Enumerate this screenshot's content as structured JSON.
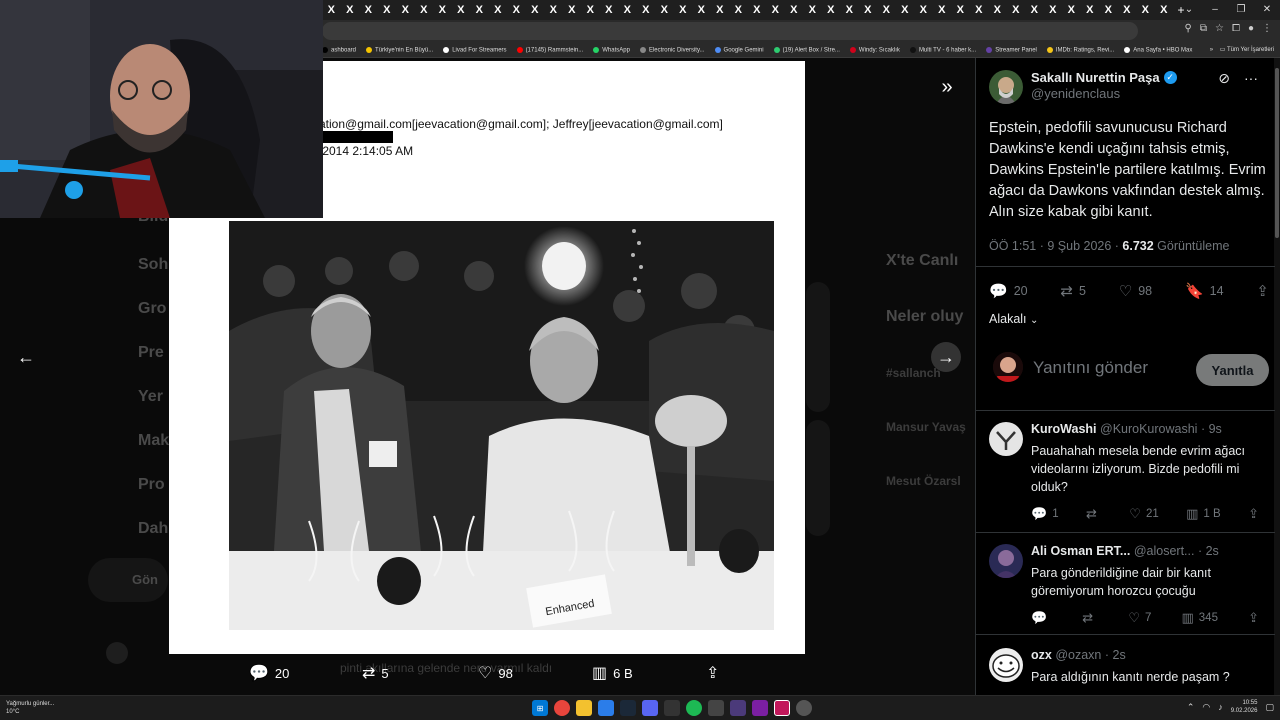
{
  "browser": {
    "tab_glyph": "X",
    "tab_count": 46,
    "new_tab": "+",
    "bookmarks": [
      {
        "label": "ashboard",
        "color": "#000000"
      },
      {
        "label": "Türkiye'nin En Büyü...",
        "color": "#f5c400"
      },
      {
        "label": "Livad For Streamers",
        "color": "#ffffff"
      },
      {
        "label": "(17145) Rammstein...",
        "color": "#ff0000"
      },
      {
        "label": "WhatsApp",
        "color": "#25d366"
      },
      {
        "label": "Electronic Diversity...",
        "color": "#888888"
      },
      {
        "label": "Google Gemini",
        "color": "#4f8df5"
      },
      {
        "label": "(19) Alert Box / Stre...",
        "color": "#2ecc71"
      },
      {
        "label": "Windy: Sıcaklık",
        "color": "#d0021b"
      },
      {
        "label": "Multi TV - 6 haber k...",
        "color": "#111111"
      },
      {
        "label": "Streamer Panel",
        "color": "#6441a5"
      },
      {
        "label": "IMDb: Ratings, Revi...",
        "color": "#f5c518"
      },
      {
        "label": "Ana Sayfa • HBO Max",
        "color": "#ffffff"
      }
    ],
    "bookmarks_more": "»",
    "all_bookmarks": "Tüm Yer İşaretleri"
  },
  "background": {
    "nav_items": [
      "Bildi",
      "Soh",
      "Gro",
      "Pre",
      "Yer",
      "Mak",
      "Pro",
      "Dah"
    ],
    "post_button": "Gön",
    "right_headings": [
      "X'te Canlı",
      "Neler oluy"
    ],
    "ghost_lines": [
      "#sallanch",
      "Mansur Yavaş",
      "Mesut Özarsl"
    ],
    "ghost_tweet": "pinti akıllarına gelende nere varmıl kaldı"
  },
  "document": {
    "to_line": "ation@gmail.com[jeevacation@gmail.com]; Jeffrey[jeevacation@gmail.com]",
    "date_line": "/2014 2:14:05 AM"
  },
  "media_actions": {
    "replies": "20",
    "reposts": "5",
    "likes": "98",
    "views": "6 B"
  },
  "tweet": {
    "author_name": "Sakallı Nurettin Paşa",
    "author_handle": "@yenidenclaus",
    "text": "Epstein, pedofili savunucusu Richard Dawkins'e kendi uçağını tahsis etmiş, Dawkins Epstein'le partilere katılmış. Evrim ağacı da Dawkons vakfından destek almış. Alın size kabak gibi kanıt.",
    "time": "ÖÖ 1:51 · 9 Şub 2026 · ",
    "views_count": "6.732",
    "views_label": " Görüntüleme",
    "replies": "20",
    "reposts": "5",
    "likes": "98",
    "bookmarks": "14",
    "relevant_label": "Alakalı",
    "reply_placeholder": "Yanıtını gönder",
    "reply_button": "Yanıtla"
  },
  "replies": [
    {
      "name": "KuroWashi",
      "handle": "@KuroKurowashi",
      "time": "· 9s",
      "text": "Pauahahah mesela bende evrim ağacı videolarını izliyorum. Bizde pedofili mi olduk?",
      "replies": "1",
      "reposts": "",
      "likes": "21",
      "views": "1 B"
    },
    {
      "name": "Ali Osman ERT...",
      "handle": "@alosert...",
      "time": "· 2s",
      "text": "Para gönderildiğine dair bir kanıt göremiyorum horozcu çocuğu",
      "replies": "",
      "reposts": "",
      "likes": "7",
      "views": "345"
    },
    {
      "name": "ozx",
      "handle": "@ozaxn",
      "time": "· 2s",
      "text": "Para aldığının kanıtı nerde paşam ?",
      "replies": "",
      "reposts": "",
      "likes": "",
      "views": ""
    }
  ],
  "taskbar": {
    "weather_text": "Yağmurlu günler...",
    "weather_temp": "10°C",
    "clock_time": "10:55",
    "clock_date": "9.02.2026"
  }
}
